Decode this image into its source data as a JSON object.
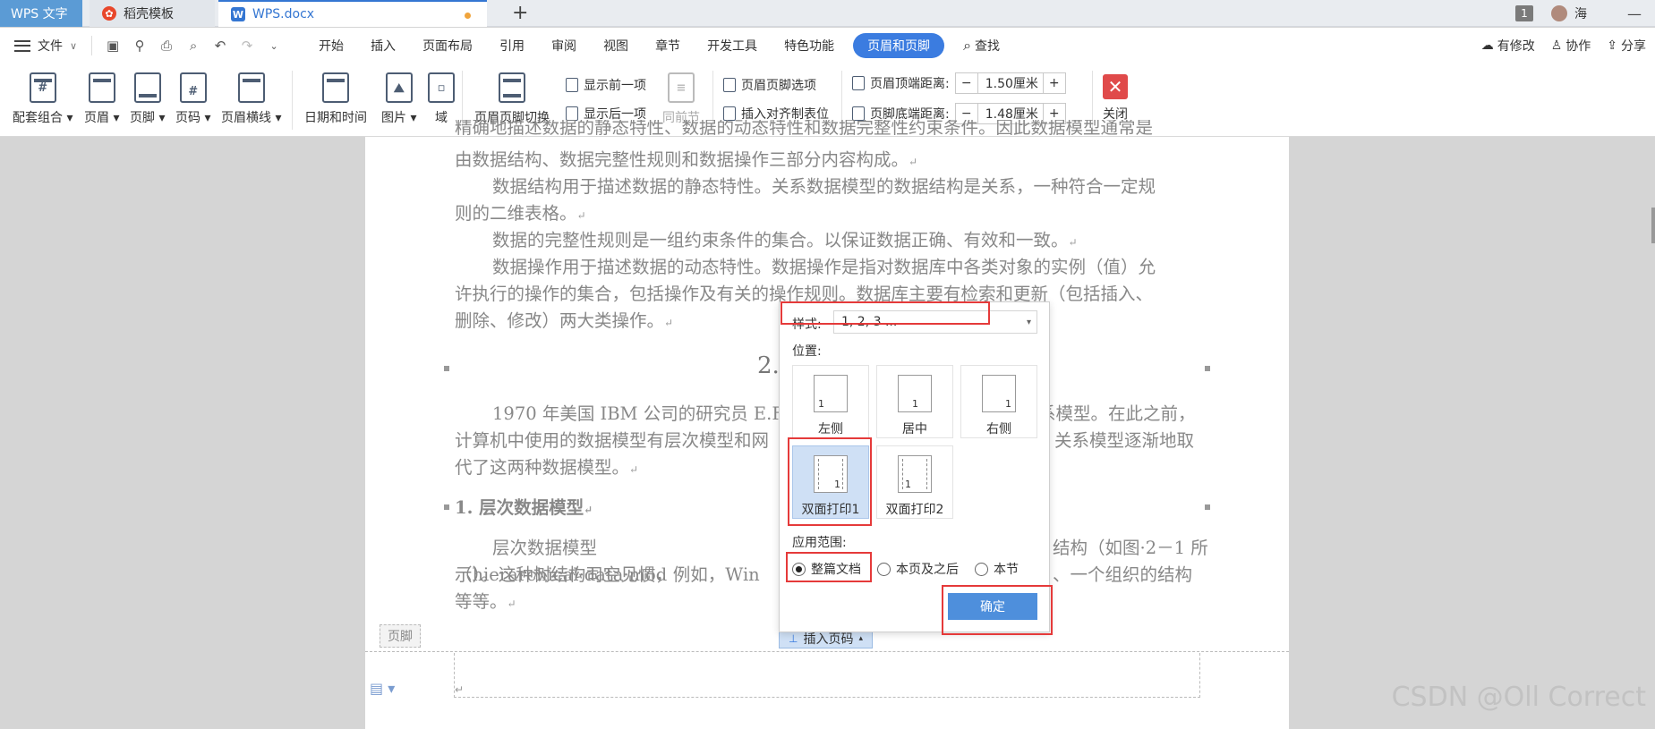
{
  "titlebar": {
    "tabs": [
      {
        "label": "WPS 文字"
      },
      {
        "label": "稻壳模板"
      },
      {
        "label": "WPS.docx"
      }
    ],
    "window_count": "1",
    "user": "海"
  },
  "menubar": {
    "file": "文件",
    "items": [
      "开始",
      "插入",
      "页面布局",
      "引用",
      "审阅",
      "视图",
      "章节",
      "开发工具",
      "特色功能"
    ],
    "active": "页眉和页脚",
    "find": "查找",
    "right": [
      "有修改",
      "协作",
      "分享"
    ]
  },
  "ribbon": {
    "buttons": {
      "template": "配套组合",
      "header": "页眉",
      "footer": "页脚",
      "page_number": "页码",
      "header_line": "页眉横线",
      "date_time": "日期和时间",
      "picture": "图片",
      "field": "域",
      "switch": "页眉页脚切换",
      "prev": "显示前一项",
      "next": "显示后一项",
      "same_prev": "同前节",
      "options": "页眉页脚选项",
      "align_tab": "插入对齐制表位",
      "close": "关闭"
    },
    "header_distance": {
      "label": "页眉顶端距离:",
      "value": "1.50厘米"
    },
    "footer_distance": {
      "label": "页脚底端距离:",
      "value": "1.48厘米"
    }
  },
  "document": {
    "line0": "精确地描述数据的静态特性、数据的动态特性和数据完整性约束条件。因此数据模型通常是",
    "line1": "由数据结构、数据完整性规则和数据操作三部分内容构成。",
    "p2a": "数据结构用于描述数据的静态特性。关系数据模型的数据结构是关系，一种符合一定规",
    "p2b": "则的二维表格。",
    "p3": "数据的完整性规则是一组约束条件的集合。以保证数据正确、有效和一致。",
    "p4a": "数据操作用于描述数据的动态特性。数据操作是指对数据库中各类对象的实例（值）允",
    "p4b": "许执行的操作的集合，包括操作及有关的操作规则。数据库主要有检索和更新（包括插入、",
    "p4c": "删除、修改）两大类操作。",
    "heading": "2.",
    "p5a_left": "1970 年美国 IBM 公司的研究员 E.F",
    "p5a_right": "系模型。在此之前，",
    "p5b_left": "计算机中使用的数据模型有层次模型和网",
    "p5b_right": "关系模型逐渐地取",
    "p5c": "代了这两种数据模型。",
    "subheading": "1. 层次数据模型",
    "p6a_left": "层次数据模型（hierarchical·data·mod",
    "p6a_right": "结构（如图·2－1 所",
    "p6b_left": "示）。这种树结构司空见惯，例如，Win",
    "p6b_right": "、一个组织的结构",
    "p6c": "等等。",
    "footer_tag": "页脚",
    "insert_page_number": "插入页码"
  },
  "popup": {
    "style_label": "样式:",
    "style_value": "1, 2, 3 ...",
    "position_label": "位置:",
    "positions": [
      {
        "label": "左侧",
        "num": "1"
      },
      {
        "label": "居中",
        "num": "1"
      },
      {
        "label": "右侧",
        "num": "1"
      },
      {
        "label": "双面打印1",
        "num": "1"
      },
      {
        "label": "双面打印2",
        "num": "1"
      }
    ],
    "scope_label": "应用范围:",
    "scopes": [
      "整篇文档",
      "本页及之后",
      "本节"
    ],
    "ok": "确定"
  },
  "watermark": "CSDN @Oll Correct"
}
